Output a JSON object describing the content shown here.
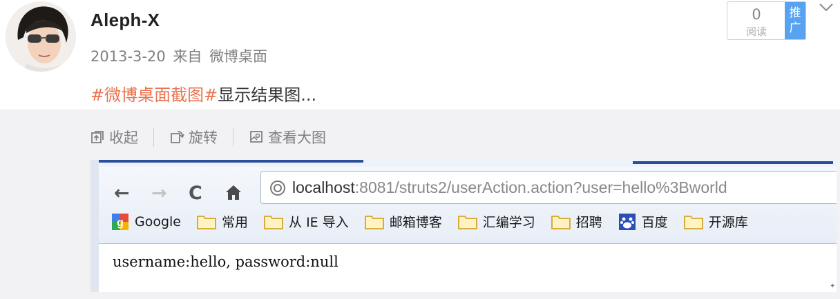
{
  "post": {
    "username": "Aleph-X",
    "date": "2013-3-20",
    "source_prefix": "来自",
    "source": "微博桌面",
    "topic": "#微博桌面截图#",
    "text": "显示结果图..."
  },
  "stats": {
    "read_count": "0",
    "read_label": "阅读",
    "promote_label": "推广"
  },
  "media_toolbar": {
    "collapse": "收起",
    "rotate": "旋转",
    "view_large": "查看大图"
  },
  "browser": {
    "url_host": "localhost",
    "url_rest": ":8081/struts2/userAction.action?user=hello%3Bworld",
    "bookmarks": [
      {
        "label": "Google",
        "icon": "google-icon"
      },
      {
        "label": "常用",
        "icon": "folder-icon"
      },
      {
        "label": "从 IE 导入",
        "icon": "folder-icon"
      },
      {
        "label": "邮箱博客",
        "icon": "folder-icon"
      },
      {
        "label": "汇编学习",
        "icon": "folder-icon"
      },
      {
        "label": "招聘",
        "icon": "folder-icon"
      },
      {
        "label": "百度",
        "icon": "baidu-icon"
      },
      {
        "label": "开源库",
        "icon": "folder-icon"
      }
    ],
    "page_output": "username:hello, password:null"
  },
  "colors": {
    "topic": "#eb7350",
    "promote_bg": "#57a3f0",
    "panel_bg": "#f2f2f5"
  }
}
